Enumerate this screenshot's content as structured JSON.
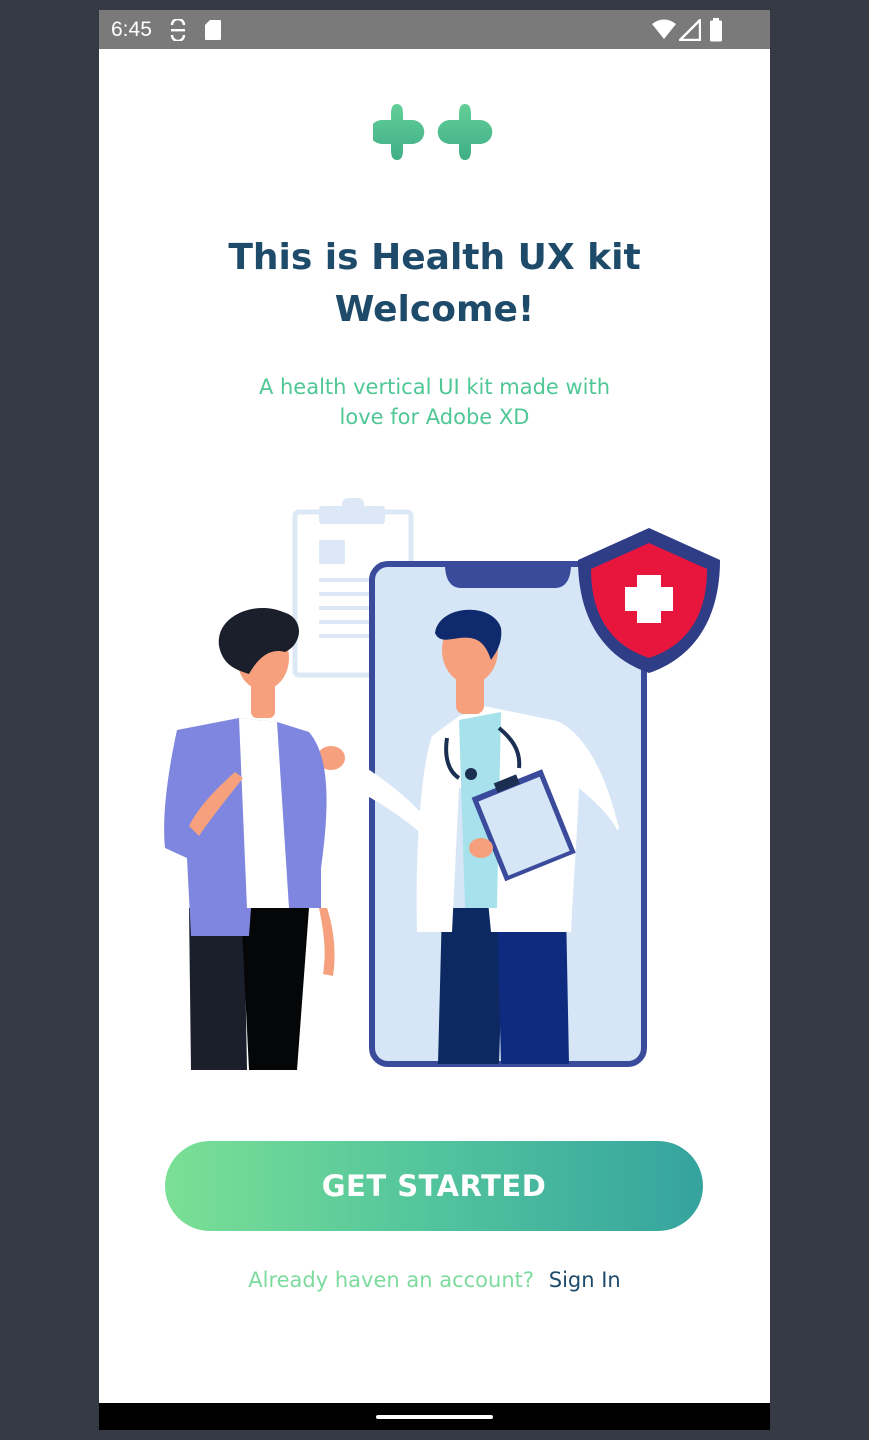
{
  "status_bar": {
    "time": "6:45",
    "left_icons": [
      "sync-icon",
      "sd-card-icon"
    ],
    "right_icons": [
      "wifi-icon",
      "cellular-signal-icon",
      "battery-icon"
    ]
  },
  "logo": {
    "icon": "double-medical-cross-icon",
    "color": "#4cc48f"
  },
  "welcome": {
    "title_line1": "This is Health UX kit",
    "title_line2": "Welcome!",
    "subtitle_line1": "A health vertical UI kit made with",
    "subtitle_line2": "love for Adobe XD"
  },
  "illustration": {
    "icon": "patient-doctor-telehealth-illustration",
    "colors": {
      "phone_frame": "#3b4b9c",
      "phone_screen": "#d6e6f6",
      "shield": "#e8163c",
      "jacket": "#7e86e0"
    }
  },
  "actions": {
    "get_started_label": "GET STARTED",
    "signin_prompt": "Already haven an account?",
    "signin_link": "Sign In"
  },
  "colors": {
    "title": "#1f4b6b",
    "subtitle": "#4fc796",
    "button_gradient_start": "#7be095",
    "button_gradient_end": "#35a39e",
    "signin_prompt": "#7ddb9d",
    "signin_link": "#1f4b6b"
  }
}
